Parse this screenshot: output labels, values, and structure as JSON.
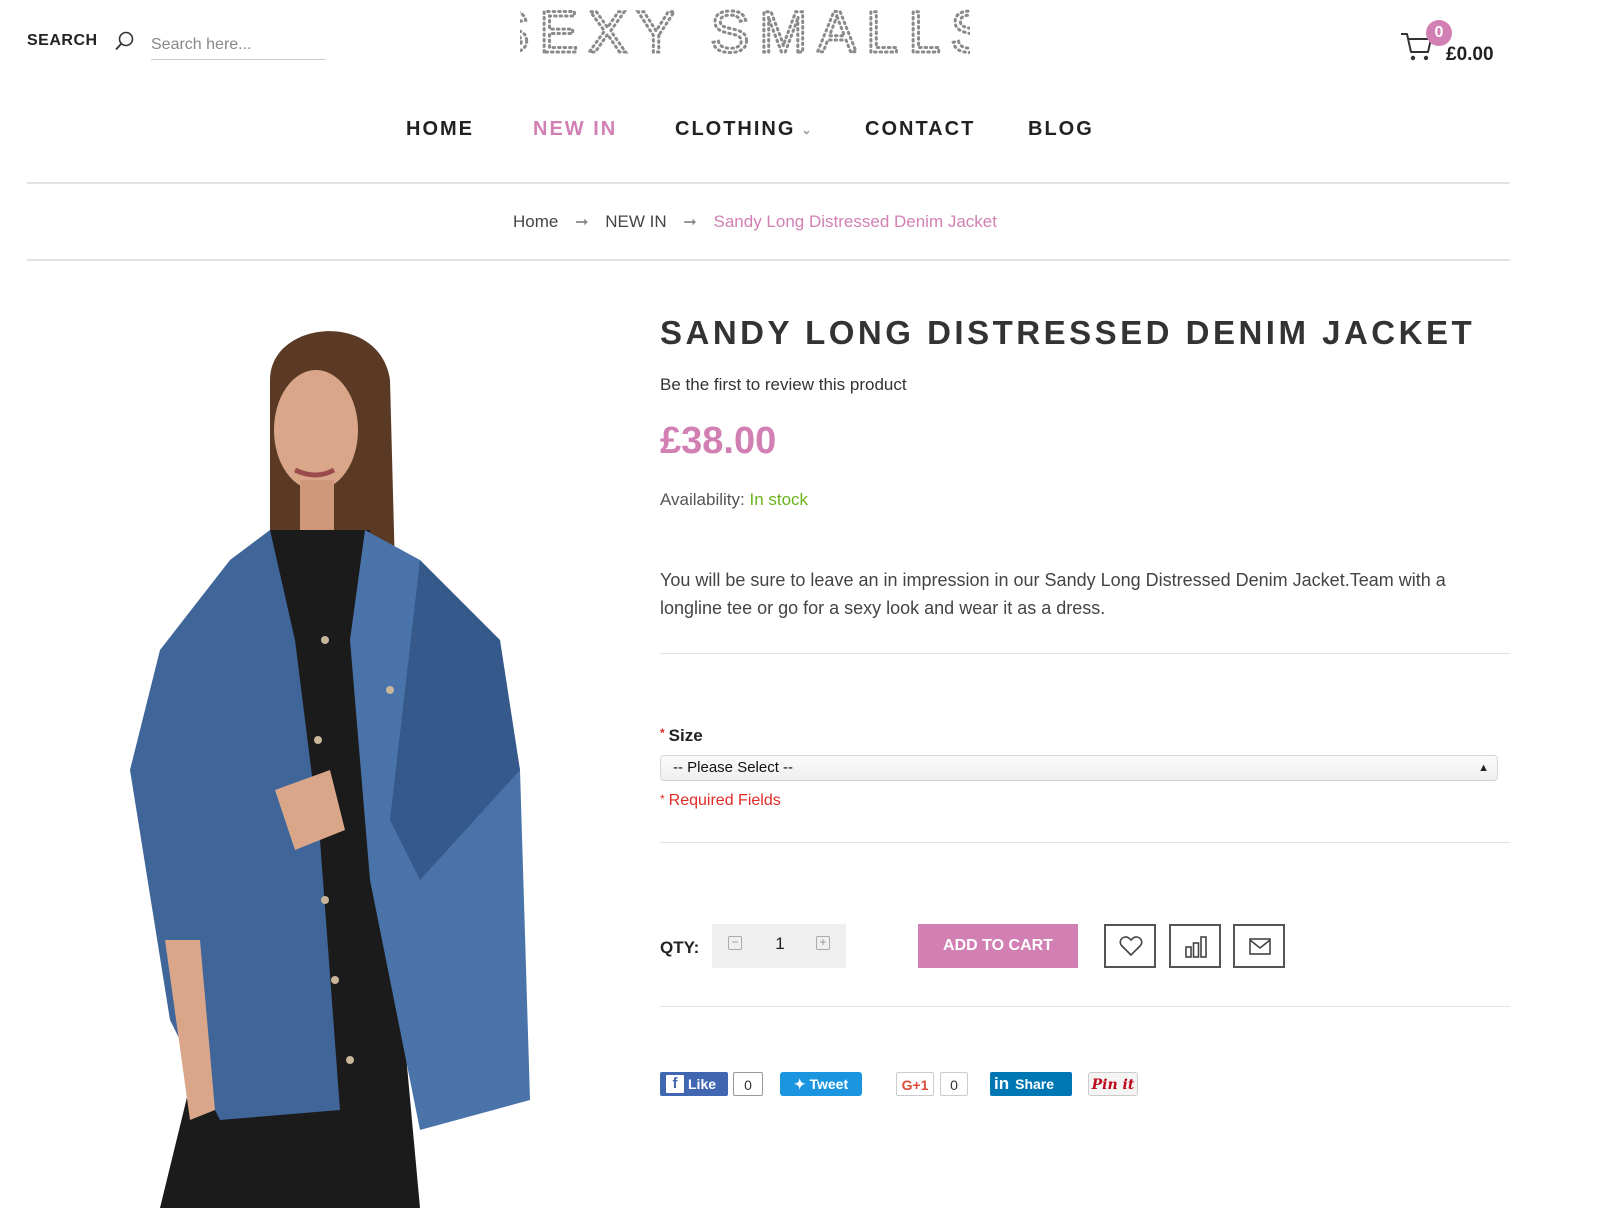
{
  "header": {
    "search_label": "SEARCH",
    "search_placeholder": "Search here...",
    "logo_text": "SEXY SMALLS",
    "cart_count": "0",
    "cart_total": "£0.00"
  },
  "nav": {
    "items": [
      {
        "label": "HOME"
      },
      {
        "label": "NEW IN",
        "active": true
      },
      {
        "label": "CLOTHING"
      },
      {
        "label": "CONTACT"
      },
      {
        "label": "BLOG"
      }
    ]
  },
  "breadcrumb": {
    "items": [
      "Home",
      "NEW IN",
      "Sandy Long Distressed Denim Jacket"
    ]
  },
  "product": {
    "title": "SANDY LONG DISTRESSED DENIM JACKET",
    "review_text": "Be the first to review this product",
    "price": "£38.00",
    "availability_label": "Availability:",
    "availability_value": "In stock",
    "description": "You will be sure to leave an in impression in our Sandy Long Distressed Denim Jacket.Team with a longline tee or go for a sexy look and wear it as a dress.",
    "size_label": "Size",
    "size_select_value": "-- Please Select --",
    "required_note": "Required Fields",
    "qty_label": "QTY:",
    "qty_value": "1",
    "add_to_cart_label": "ADD TO CART"
  },
  "social": {
    "like_label": "Like",
    "like_count": "0",
    "tweet_label": "Tweet",
    "gplus_label": "G+1",
    "gplus_count": "0",
    "linkedin_label": "Share",
    "pinit_label": "Pin it"
  },
  "colors": {
    "accent": "#d27fb4",
    "in_stock": "#6bb31b",
    "required": "#e02b27"
  },
  "icons": [
    "search-icon",
    "cart-icon",
    "chevron-down-icon",
    "arrow-right-icon",
    "heart-icon",
    "compare-icon",
    "envelope-icon",
    "facebook-icon",
    "twitter-icon",
    "linkedin-icon"
  ]
}
